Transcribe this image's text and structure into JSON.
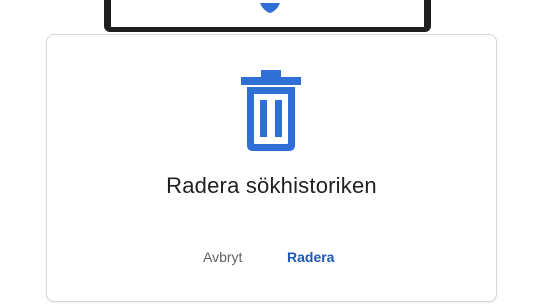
{
  "dialog": {
    "title": "Radera sökhistoriken",
    "cancel_label": "Avbryt",
    "delete_label": "Radera"
  },
  "icons": {
    "top": "shield-icon",
    "main": "trash-icon"
  },
  "colors": {
    "accent": "#2f6fd6",
    "primary_button": "#1a57b8",
    "secondary_button": "#5f6368",
    "title_text": "#202124"
  }
}
